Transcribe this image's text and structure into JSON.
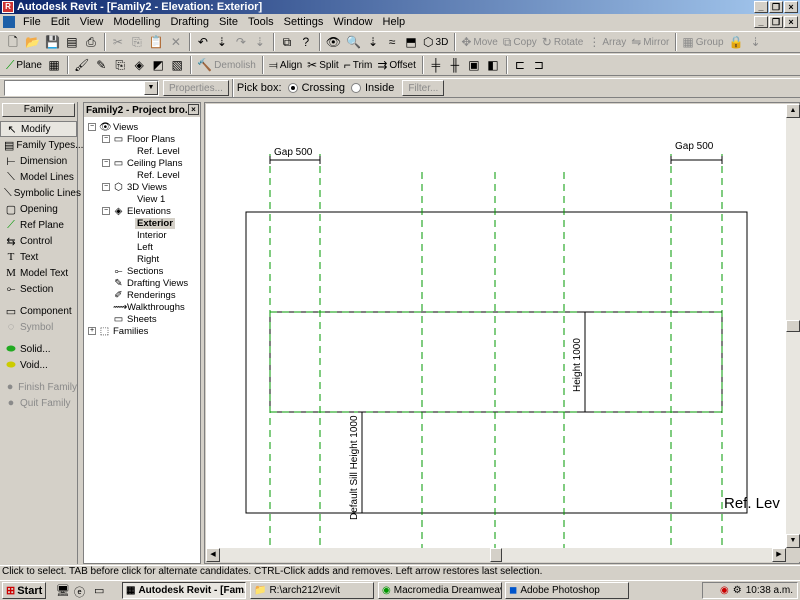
{
  "window": {
    "title": "Autodesk Revit - [Family2 - Elevation: Exterior]"
  },
  "menu": [
    "File",
    "Edit",
    "View",
    "Modelling",
    "Drafting",
    "Site",
    "Tools",
    "Settings",
    "Window",
    "Help"
  ],
  "toolbar1": {
    "view_3d": "3D",
    "move": "Move",
    "copy": "Copy",
    "rotate": "Rotate",
    "array": "Array",
    "mirror": "Mirror",
    "group": "Group"
  },
  "toolbar2": {
    "plane": "Plane",
    "demolish": "Demolish",
    "align": "Align",
    "split": "Split",
    "trim": "Trim",
    "offset": "Offset"
  },
  "toolbar3": {
    "properties": "Properties...",
    "pickbox_label": "Pick box:",
    "crossing": "Crossing",
    "inside": "Inside",
    "filter": "Filter..."
  },
  "family_panel": {
    "header": "Family",
    "items": [
      "Modify",
      "Family Types...",
      "Dimension",
      "Model Lines",
      "Symbolic Lines",
      "Opening",
      "Ref Plane",
      "Control",
      "Text",
      "Model Text",
      "Section",
      "Component",
      "Symbol",
      "Solid...",
      "Void...",
      "Finish Family",
      "Quit Family"
    ]
  },
  "browser": {
    "header": "Family2 - Project bro...",
    "views": "Views",
    "floor_plans": "Floor Plans",
    "fp_ref": "Ref. Level",
    "ceiling_plans": "Ceiling Plans",
    "cp_ref": "Ref. Level",
    "views_3d": "3D Views",
    "view1": "View 1",
    "elevations": "Elevations",
    "exterior": "Exterior",
    "interior": "Interior",
    "left": "Left",
    "right": "Right",
    "sections": "Sections",
    "drafting_views": "Drafting Views",
    "renderings": "Renderings",
    "walkthroughs": "Walkthroughs",
    "sheets": "Sheets",
    "families": "Families"
  },
  "drawing": {
    "gap_left": "Gap 500",
    "gap_right": "Gap 500",
    "height": "Height 1000",
    "sill": "Default Sill Height 1000",
    "ref_level": "Ref. Lev"
  },
  "statusbar": "Click to select. TAB before click for alternate candidates. CTRL-Click adds and removes. Left arrow restores last selection.",
  "taskbar": {
    "start": "Start",
    "tasks": [
      "Autodesk Revit - [Fam...",
      "R:\\arch212\\revit",
      "Macromedia Dreamweave...",
      "Adobe Photoshop"
    ],
    "clock": "10:38 a.m."
  },
  "colors": {
    "ref_plane": "#009900",
    "title_start": "#0a246a",
    "title_end": "#a6caf0"
  }
}
